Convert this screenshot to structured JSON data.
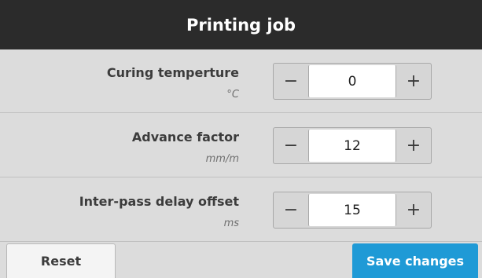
{
  "header": {
    "title": "Printing job"
  },
  "settings": [
    {
      "label": "Curing temperture",
      "unit": "°C",
      "value": "0",
      "decrement": "−",
      "increment": "+"
    },
    {
      "label": "Advance factor",
      "unit": "mm/m",
      "value": "12",
      "decrement": "−",
      "increment": "+"
    },
    {
      "label": "Inter-pass delay offset",
      "unit": "ms",
      "value": "15",
      "decrement": "−",
      "increment": "+"
    }
  ],
  "footer": {
    "reset_label": "Reset",
    "save_label": "Save changes"
  },
  "colors": {
    "header_bg": "#2b2b2b",
    "accent": "#1f9ad6",
    "panel_bg": "#dcdcdc"
  }
}
